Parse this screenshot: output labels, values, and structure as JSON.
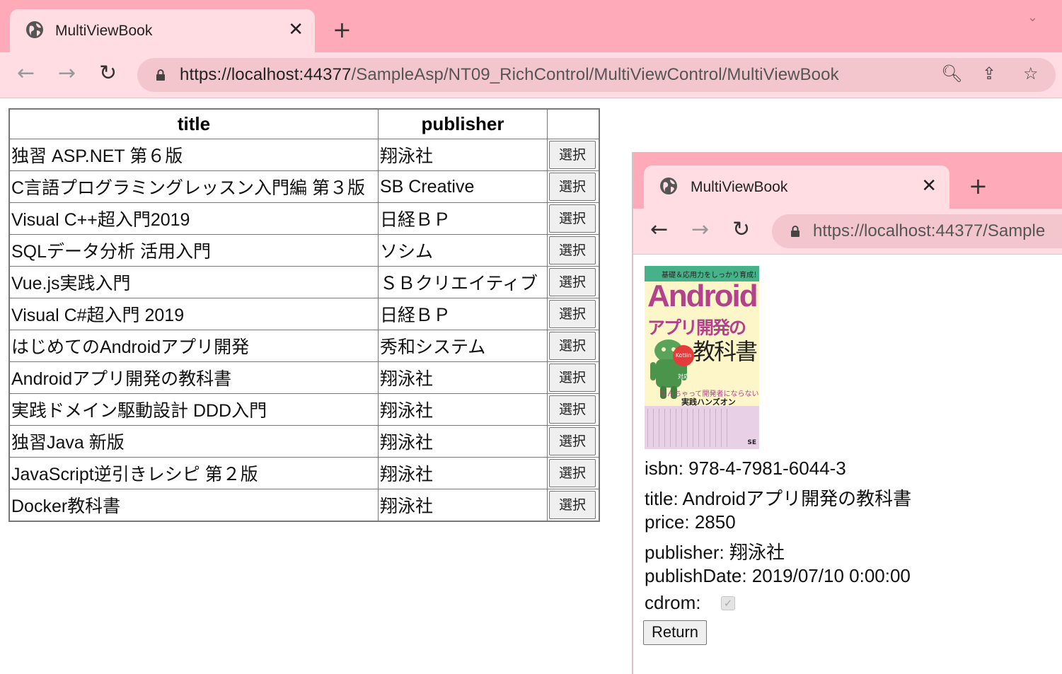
{
  "browser": {
    "tab_title": "MultiViewBook",
    "url_host": "https://localhost:44377",
    "url_path": "/SampleAsp/NT09_RichControl/MultiViewControl/MultiViewBook"
  },
  "grid": {
    "headers": [
      "title",
      "publisher",
      ""
    ],
    "select_label": "選択",
    "rows": [
      {
        "title": "独習 ASP.NET 第６版",
        "publisher": "翔泳社"
      },
      {
        "title": "C言語プログラミングレッスン入門編 第３版",
        "publisher": "SB Creative"
      },
      {
        "title": "Visual C++超入門2019",
        "publisher": "日経ＢＰ"
      },
      {
        "title": "SQLデータ分析 活用入門",
        "publisher": "ソシム"
      },
      {
        "title": "Vue.js実践入門",
        "publisher": "ＳＢクリエイティブ"
      },
      {
        "title": "Visual C#超入門 2019",
        "publisher": "日経ＢＰ"
      },
      {
        "title": "はじめてのAndroidアプリ開発",
        "publisher": "秀和システム"
      },
      {
        "title": "Androidアプリ開発の教科書",
        "publisher": "翔泳社"
      },
      {
        "title": "実践ドメイン駆動設計 DDD入門",
        "publisher": "翔泳社"
      },
      {
        "title": "独習Java 新版",
        "publisher": "翔泳社"
      },
      {
        "title": "JavaScript逆引きレシピ 第２版",
        "publisher": "翔泳社"
      },
      {
        "title": "Docker教科書",
        "publisher": "翔泳社"
      }
    ]
  },
  "popup": {
    "tab_title": "MultiViewBook",
    "url_visible": "https://localhost:44377/Sample",
    "cover": {
      "band": "基礎＆応用力をしっかり育成！",
      "big": "Android",
      "line1": "アプリ開発の",
      "line2": "教科書",
      "kotlin": "Kotlin対応",
      "tag1": "なんちゃって開発者にならないための",
      "tag2": "実践ハンズオン",
      "publisher": "SE"
    },
    "details": [
      {
        "label": "isbn:",
        "value": "978-4-7981-6044-3"
      },
      {
        "label": "title:",
        "value": "Androidアプリ開発の教科書"
      },
      {
        "label": "price:",
        "value": "2850"
      },
      {
        "label": "publisher:",
        "value": "翔泳社"
      },
      {
        "label": "publishDate:",
        "value": "2019/07/10 0:00:00"
      }
    ],
    "cdrom_label": "cdrom:",
    "cdrom_checked": true,
    "return_label": "Return"
  }
}
